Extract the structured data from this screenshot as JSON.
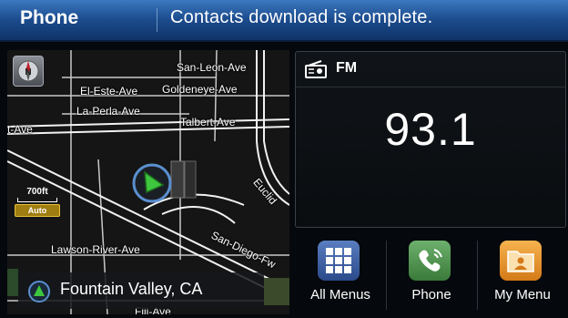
{
  "header": {
    "title": "Phone",
    "message": "Contacts download is complete."
  },
  "map": {
    "streets": {
      "san_leon": "San-Leon-Ave",
      "el_este": "El-Este-Ave",
      "goldeneye": "Goldeneye-Ave",
      "la_perla": "La-Perla-Ave",
      "talbert": "Talbert-Ave",
      "ave_left": "t-Ave",
      "lawson_river": "Lawson-River-Ave",
      "euclid": "Euclid",
      "san_diego": "San-Diego-Fw",
      "fiji": "Fiji-Ave"
    },
    "scale": "700ft",
    "scale_mode": "Auto",
    "location": "Fountain Valley, CA"
  },
  "radio": {
    "band": "FM",
    "frequency": "93.1"
  },
  "menu": {
    "items": [
      {
        "label": "All Menus",
        "icon": "grid-icon"
      },
      {
        "label": "Phone",
        "icon": "phone-icon"
      },
      {
        "label": "My Menu",
        "icon": "folder-icon"
      }
    ]
  },
  "colors": {
    "header_blue": "#1c4c8e",
    "nav_arrow": "#3ec63e",
    "menu_phone_green": "#4c9a4c",
    "menu_folder_orange": "#f0a23a"
  }
}
